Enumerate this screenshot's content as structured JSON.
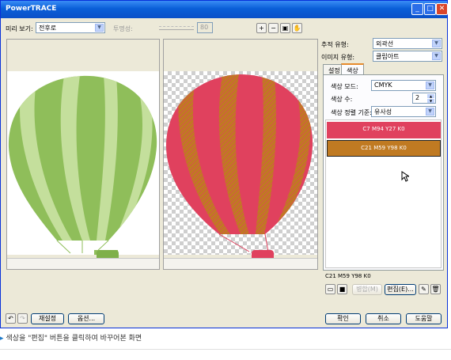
{
  "window": {
    "title": "PowerTRACE"
  },
  "toolbar": {
    "preview_label": "미리 보기:",
    "preview_value": "전후로",
    "transparency_label": "투명성:",
    "transparency_value": "80"
  },
  "right_panel": {
    "trace_type_label": "추적 유형:",
    "trace_type_value": "외곽선",
    "image_type_label": "이미지 유형:",
    "image_type_value": "클립아트",
    "tabs": [
      {
        "label": "설정"
      },
      {
        "label": "색상"
      }
    ],
    "color_mode_label": "색상 모드:",
    "color_mode_value": "CMYK",
    "color_count_label": "색상 수:",
    "color_count_value": "2",
    "sort_label": "색상 정렬 기준:",
    "sort_value": "유사성",
    "colors": [
      {
        "label": "C7 M94 Y27 K0",
        "hex": "#e0415e"
      },
      {
        "label": "C21 M59 Y98 K0",
        "hex": "#c07a22"
      }
    ],
    "selected_color_label": "C21 M59 Y98 K0",
    "merge_button": "병합(M)",
    "edit_button": "편집(E)..."
  },
  "bottom": {
    "reset_button": "재설정",
    "options_button": "옵션...",
    "ok_button": "확인",
    "cancel_button": "취소",
    "help_button": "도움말"
  },
  "caption": "색상을 \"편집\" 버튼을 클릭하여 바꾸어본 화면",
  "colors": {
    "balloon_green": "#8fbe5a",
    "balloon_light_green": "#c4df9c",
    "balloon_pink": "#e0415e",
    "balloon_orange": "#c07a22"
  }
}
